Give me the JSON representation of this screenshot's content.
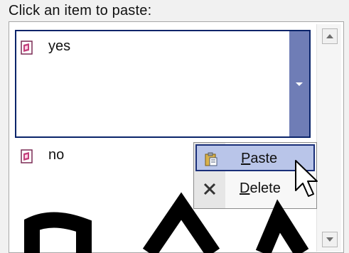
{
  "header": {
    "text": "Click an item to paste:"
  },
  "items": [
    {
      "label": "yes",
      "icon": "document-icon",
      "selected": true
    },
    {
      "label": "no",
      "icon": "document-icon",
      "selected": false
    }
  ],
  "context_menu": {
    "items": [
      {
        "label": "Paste",
        "mnemonic": "P",
        "icon": "clipboard-paste-icon"
      },
      {
        "label": "Delete",
        "mnemonic": "D",
        "icon": "delete-x-icon"
      }
    ]
  },
  "colors": {
    "selection_border": "#0a246a",
    "dropdown_button": "#6f7db6",
    "menu_hover": "#b9c5e9"
  }
}
